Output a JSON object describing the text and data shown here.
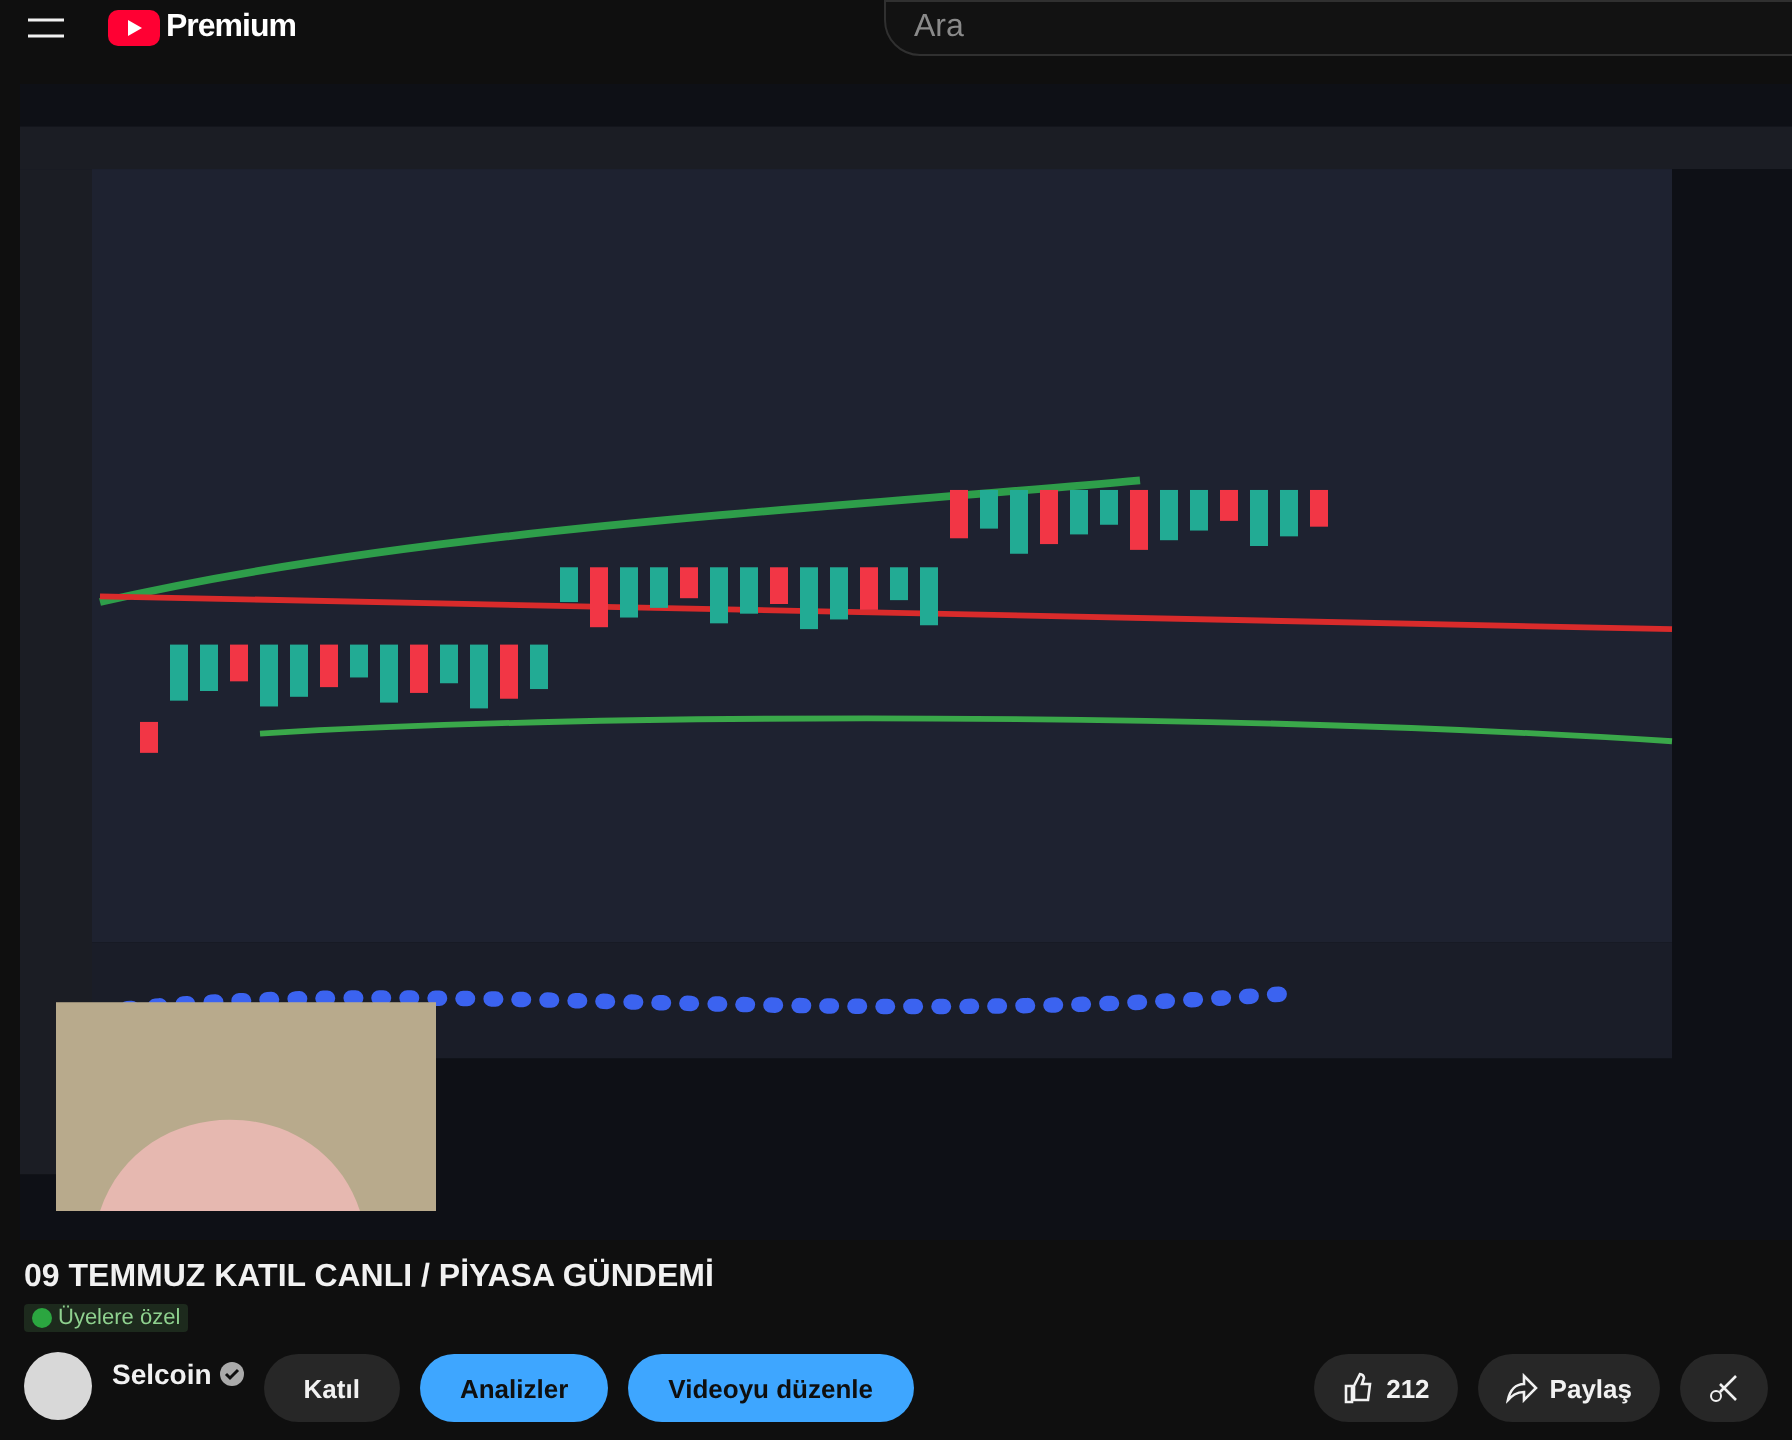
{
  "header": {
    "logo_text": "Premium",
    "search": {
      "placeholder": "Ara"
    }
  },
  "title": "09 TEMMUZ KATIL CANLI / PİYASA GÜNDEMİ",
  "badge": "Üyelere özel",
  "channel": {
    "name": "Selcoin",
    "verified": true
  },
  "buttons": [
    {
      "kind": "plain",
      "label": "Katıl"
    },
    {
      "kind": "accent",
      "label": "Analizler"
    },
    {
      "kind": "accent",
      "label": "Videoyu düzenle"
    }
  ],
  "actions": [
    {
      "kind": "like",
      "label": "212"
    },
    {
      "kind": "share",
      "label": "Paylaş"
    },
    {
      "kind": "clip"
    }
  ]
}
